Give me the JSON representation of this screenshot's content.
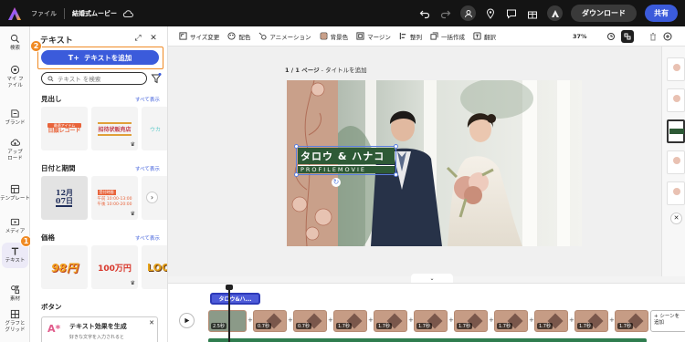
{
  "topbar": {
    "file_menu": "ファイル",
    "doc_title": "結婚式ムービー",
    "download": "ダウンロード",
    "share": "共有"
  },
  "rail": {
    "items": [
      {
        "label": "検索",
        "icon": "search-icon"
      },
      {
        "label": "マイ ファイル",
        "icon": "folder-icon"
      },
      {
        "label": "ブランド",
        "icon": "brand-icon"
      },
      {
        "label": "アップ ロード",
        "icon": "upload-icon"
      },
      {
        "label": "テンプレート",
        "icon": "template-icon"
      },
      {
        "label": "メディア",
        "icon": "media-icon"
      },
      {
        "label": "テキスト",
        "icon": "text-icon"
      },
      {
        "label": "素材",
        "icon": "elements-icon"
      },
      {
        "label": "グラフと グリッド",
        "icon": "grid-icon"
      }
    ],
    "badge_text": "1"
  },
  "panel": {
    "title": "テキスト",
    "add_button": "テキストを追加",
    "add_badge": "2",
    "search_placeholder": "テキスト を検索",
    "see_all": "すべて表示",
    "sections": [
      {
        "title": "見出し"
      },
      {
        "title": "日付と期間"
      },
      {
        "title": "価格"
      },
      {
        "title": "ボタン"
      }
    ],
    "thumbs": {
      "heading1_top": "最適アイテム",
      "heading1_main": "日顔レコード",
      "heading2": "招待状販売店",
      "date_a_top": "12月",
      "date_a_bottom": "07日",
      "date_b_badge": "受付時間",
      "date_b_line1": "午前 10:00-13:00",
      "date_b_line2": "午後 10:00-20:00",
      "price1": "98円",
      "price2": "100万円",
      "price3": "LOO"
    },
    "ai_card_text": "テキスト効果を生成",
    "ai_card_sub": "好きな文字を入力されると"
  },
  "proptool": {
    "items": [
      "サイズ変更",
      "配色",
      "アニメーション",
      "背景色",
      "マージン",
      "整列",
      "一括作成",
      "翻訳"
    ],
    "zoom": "37%"
  },
  "canvas": {
    "page_label_num": "1 / 1 ページ",
    "page_label_title": "- タイトルを追加",
    "title_text": "タロウ & ハナコ",
    "subtitle_text": "PROFILEMOVIE"
  },
  "timeline": {
    "text_clip": "タロウ&ハ...",
    "clips": [
      {
        "dur": "2.5秒"
      },
      {
        "dur": "0.7秒"
      },
      {
        "dur": "0.7秒"
      },
      {
        "dur": "1.7秒"
      },
      {
        "dur": "1.7秒"
      },
      {
        "dur": "1.7秒"
      },
      {
        "dur": "1.7秒"
      },
      {
        "dur": "1.7秒"
      },
      {
        "dur": "1.7秒"
      },
      {
        "dur": "1.7秒"
      },
      {
        "dur": "1.7秒"
      }
    ],
    "add_scene": "+ シーンを追加"
  },
  "colors": {
    "accent": "#3b5bdb",
    "highlight": "#f08a24",
    "title_green": "#2e5a36"
  }
}
